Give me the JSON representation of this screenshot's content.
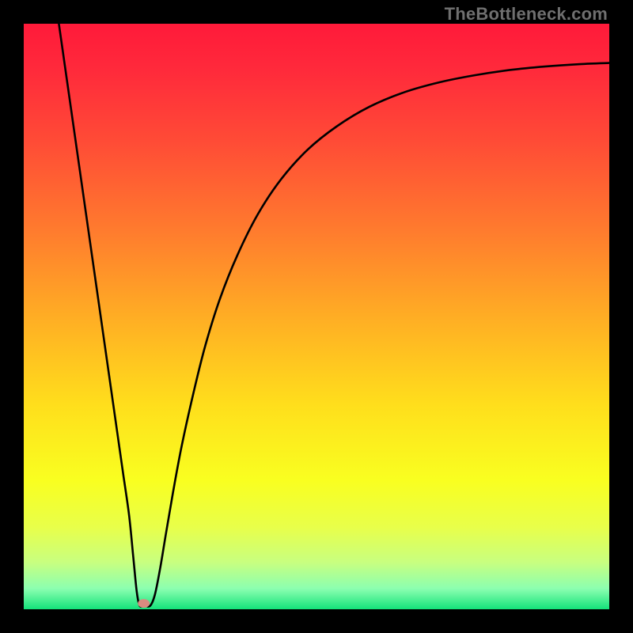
{
  "watermark": "TheBottleneck.com",
  "chart_data": {
    "type": "line",
    "title": "",
    "xlabel": "",
    "ylabel": "",
    "xlim": [
      0,
      100
    ],
    "ylim": [
      0,
      100
    ],
    "grid": false,
    "legend": false,
    "annotations": [],
    "background_gradient": {
      "stops": [
        {
          "pos": 0.0,
          "color": "#ff1a3a"
        },
        {
          "pos": 0.08,
          "color": "#ff2a3b"
        },
        {
          "pos": 0.2,
          "color": "#ff4b36"
        },
        {
          "pos": 0.35,
          "color": "#ff7a2e"
        },
        {
          "pos": 0.5,
          "color": "#ffad24"
        },
        {
          "pos": 0.65,
          "color": "#ffde1c"
        },
        {
          "pos": 0.78,
          "color": "#f9ff20"
        },
        {
          "pos": 0.86,
          "color": "#e8ff4a"
        },
        {
          "pos": 0.92,
          "color": "#c8ff80"
        },
        {
          "pos": 0.965,
          "color": "#8bffb0"
        },
        {
          "pos": 1.0,
          "color": "#14e27a"
        }
      ]
    },
    "marker": {
      "x": 20.5,
      "y": 1.0,
      "color": "#d98b80"
    },
    "series": [
      {
        "name": "curve",
        "color": "#000000",
        "points": [
          {
            "x": 6.0,
            "y": 100.0
          },
          {
            "x": 7.0,
            "y": 93.0
          },
          {
            "x": 8.0,
            "y": 86.0
          },
          {
            "x": 9.0,
            "y": 79.0
          },
          {
            "x": 10.0,
            "y": 72.0
          },
          {
            "x": 11.0,
            "y": 65.0
          },
          {
            "x": 12.0,
            "y": 58.0
          },
          {
            "x": 13.0,
            "y": 51.0
          },
          {
            "x": 14.0,
            "y": 44.0
          },
          {
            "x": 15.0,
            "y": 37.0
          },
          {
            "x": 16.0,
            "y": 30.0
          },
          {
            "x": 17.0,
            "y": 23.0
          },
          {
            "x": 18.0,
            "y": 16.0
          },
          {
            "x": 18.7,
            "y": 9.0
          },
          {
            "x": 19.3,
            "y": 3.0
          },
          {
            "x": 19.8,
            "y": 0.6
          },
          {
            "x": 20.6,
            "y": 0.6
          },
          {
            "x": 21.6,
            "y": 0.6
          },
          {
            "x": 22.4,
            "y": 2.5
          },
          {
            "x": 23.3,
            "y": 7.0
          },
          {
            "x": 24.3,
            "y": 13.0
          },
          {
            "x": 25.5,
            "y": 20.0
          },
          {
            "x": 27.0,
            "y": 28.0
          },
          {
            "x": 29.0,
            "y": 37.0
          },
          {
            "x": 31.0,
            "y": 45.0
          },
          {
            "x": 33.5,
            "y": 53.0
          },
          {
            "x": 36.5,
            "y": 60.5
          },
          {
            "x": 40.0,
            "y": 67.5
          },
          {
            "x": 44.0,
            "y": 73.5
          },
          {
            "x": 48.5,
            "y": 78.5
          },
          {
            "x": 53.5,
            "y": 82.5
          },
          {
            "x": 59.0,
            "y": 85.8
          },
          {
            "x": 65.0,
            "y": 88.3
          },
          {
            "x": 71.0,
            "y": 90.0
          },
          {
            "x": 77.0,
            "y": 91.2
          },
          {
            "x": 83.0,
            "y": 92.1
          },
          {
            "x": 89.0,
            "y": 92.7
          },
          {
            "x": 95.0,
            "y": 93.1
          },
          {
            "x": 100.0,
            "y": 93.3
          }
        ]
      }
    ]
  }
}
